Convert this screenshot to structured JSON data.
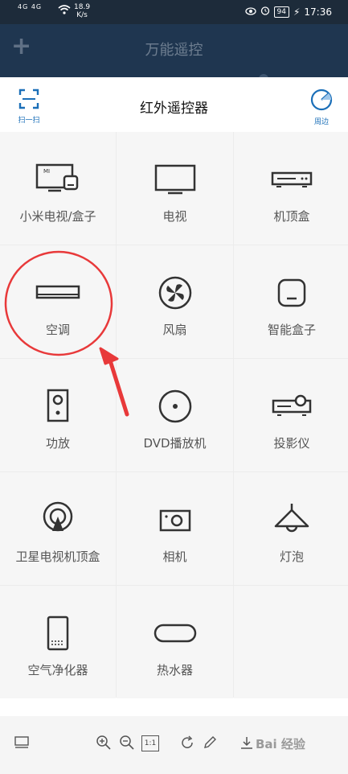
{
  "status_bar": {
    "signal": "4G 4G",
    "speed_value": "18.9",
    "speed_unit": "K/s",
    "battery": "94",
    "time": "17:36"
  },
  "app_header": {
    "title": "万能遥控",
    "add_icon": "plus-icon"
  },
  "panel": {
    "title": "红外遥控器",
    "scan_label": "扫一扫",
    "nearby_label": "周边"
  },
  "devices": [
    {
      "label": "小米电视/盒子",
      "icon": "mi-tv-box-icon"
    },
    {
      "label": "电视",
      "icon": "tv-icon"
    },
    {
      "label": "机顶盒",
      "icon": "set-top-box-icon"
    },
    {
      "label": "空调",
      "icon": "air-conditioner-icon"
    },
    {
      "label": "风扇",
      "icon": "fan-icon"
    },
    {
      "label": "智能盒子",
      "icon": "smart-box-icon"
    },
    {
      "label": "功放",
      "icon": "amplifier-icon"
    },
    {
      "label": "DVD播放机",
      "icon": "dvd-icon"
    },
    {
      "label": "投影仪",
      "icon": "projector-icon"
    },
    {
      "label": "卫星电视机顶盒",
      "icon": "satellite-icon"
    },
    {
      "label": "相机",
      "icon": "camera-icon"
    },
    {
      "label": "灯泡",
      "icon": "lamp-icon"
    },
    {
      "label": "空气净化器",
      "icon": "air-purifier-icon"
    },
    {
      "label": "热水器",
      "icon": "water-heater-icon"
    }
  ],
  "toolbar": {
    "zoom_reset_label": "1:1",
    "watermark": "Bai 经验"
  },
  "colors": {
    "accent_blue": "#1b6fb8",
    "annotation_red": "#e8393a",
    "header_dark": "#1f3650"
  }
}
